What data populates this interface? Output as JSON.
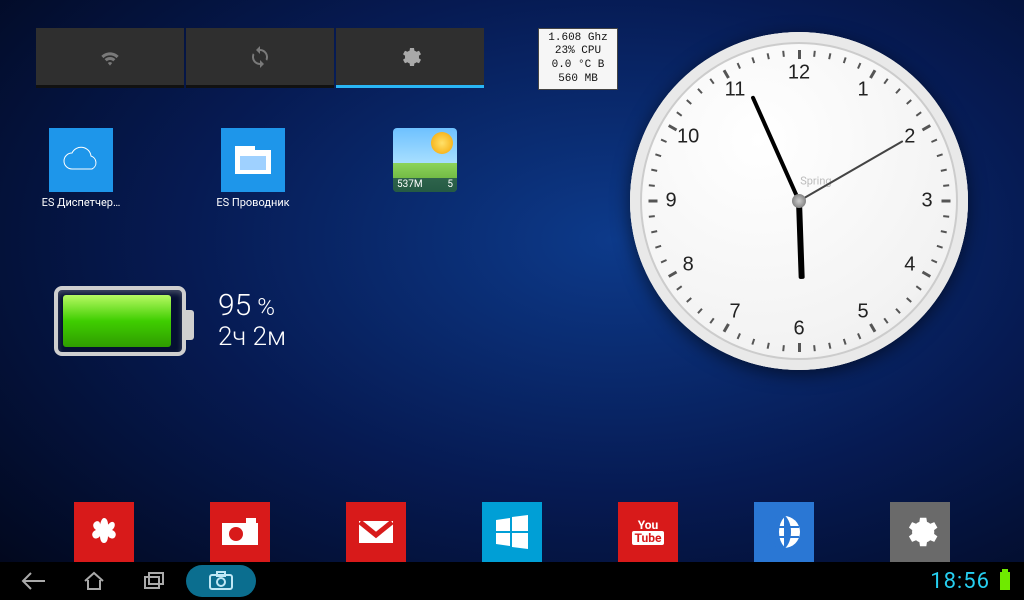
{
  "qs": {
    "tiles": [
      {
        "name": "wifi",
        "active": false
      },
      {
        "name": "sync",
        "active": false
      },
      {
        "name": "brightness",
        "active": true
      }
    ]
  },
  "cpu": {
    "line1": "1.608 Ghz",
    "line2": "23% CPU",
    "line3": "0.0 °C B",
    "line4": "560 MB"
  },
  "apps": [
    {
      "label": "ES Диспетчер…"
    },
    {
      "label": "ES Проводник"
    }
  ],
  "weather": {
    "memory": "537M",
    "count": "5"
  },
  "battery": {
    "percent_value": "95",
    "percent_sign": "%",
    "time": "2ч 2м",
    "fill_pct": 95
  },
  "clock": {
    "brand": "Spring",
    "hour": 5,
    "minute": 56,
    "second": 10
  },
  "dock": [
    {
      "name": "gallery"
    },
    {
      "name": "camera"
    },
    {
      "name": "gmail"
    },
    {
      "name": "windows"
    },
    {
      "name": "youtube"
    },
    {
      "name": "browser"
    },
    {
      "name": "settings"
    }
  ],
  "navbar": {
    "time": "18:56"
  },
  "colors": {
    "accent_cyan": "#26cff0",
    "tile_blue": "#1e96ea",
    "tile_red": "#d81a1a",
    "tile_teal": "#009fd6",
    "tile_grey": "#6a6a6a"
  }
}
